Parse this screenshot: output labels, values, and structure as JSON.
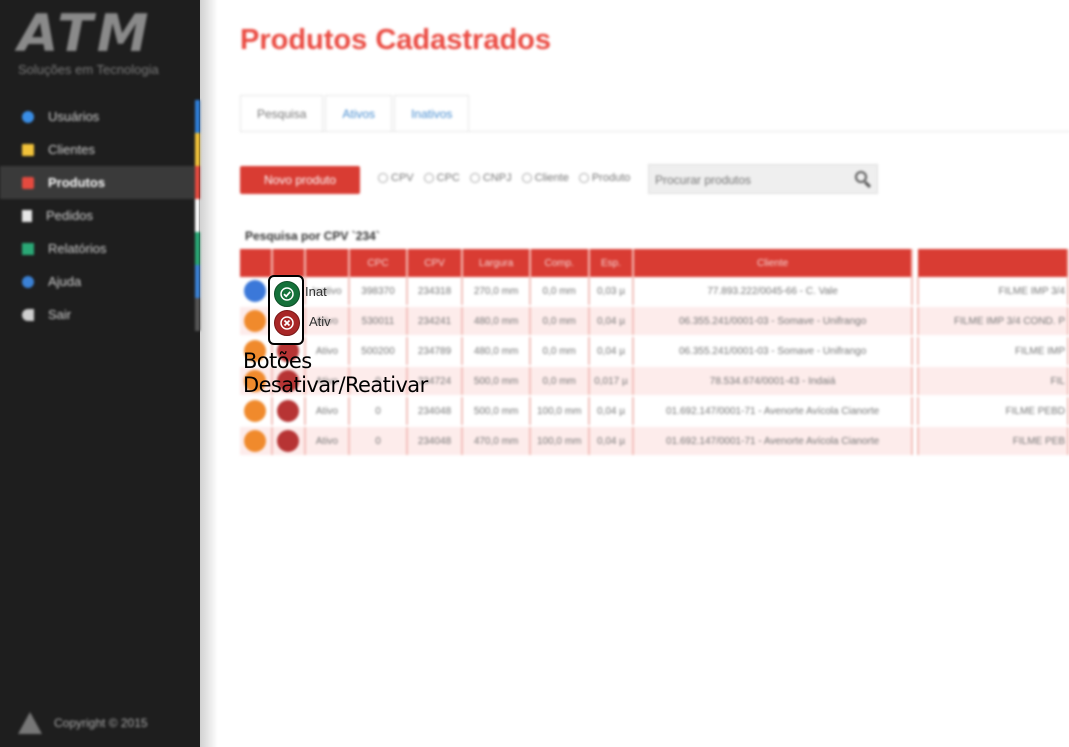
{
  "app": {
    "logo_text": "ATM",
    "logo_subtitle": "Soluções em Tecnologia",
    "footer": "Copyright © 2015"
  },
  "sidebar": {
    "items": [
      {
        "label": "Usuários",
        "icon": "user-icon",
        "icon_color": "#3a8ee6",
        "stripe": "#2f7ed8",
        "active": false
      },
      {
        "label": "Clientes",
        "icon": "envelope-icon",
        "icon_color": "#f2c33a",
        "stripe": "#f2c33a",
        "active": false
      },
      {
        "label": "Produtos",
        "icon": "product-icon",
        "icon_color": "#e54a3f",
        "stripe": "#e54a3f",
        "active": true
      },
      {
        "label": "Pedidos",
        "icon": "document-icon",
        "icon_color": "#e6e6e6",
        "stripe": "#ffffff",
        "active": false
      },
      {
        "label": "Relatórios",
        "icon": "chart-icon",
        "icon_color": "#2aa876",
        "stripe": "#2aa876",
        "active": false
      },
      {
        "label": "Ajuda",
        "icon": "help-icon",
        "icon_color": "#3b82d6",
        "stripe": "#3b82d6",
        "active": false
      },
      {
        "label": "Sair",
        "icon": "exit-icon",
        "icon_color": "#cfcfcf",
        "stripe": "#555555",
        "active": false
      }
    ]
  },
  "main": {
    "title": "Produtos Cadastrados",
    "tabs": [
      {
        "label": "Pesquisa",
        "active": true
      },
      {
        "label": "Ativos",
        "active": false
      },
      {
        "label": "Inativos",
        "active": false
      }
    ],
    "new_button": "Novo produto",
    "filters": [
      "CPV",
      "CPC",
      "CNPJ",
      "Cliente",
      "Produto"
    ],
    "search_placeholder": "Procurar produtos",
    "search_label": "Pesquisa por CPV `234`"
  },
  "table": {
    "headers": [
      "",
      "",
      "",
      "CPC",
      "CPV",
      "Largura",
      "Comp.",
      "Esp.",
      "Cliente",
      "",
      ""
    ],
    "rows": [
      {
        "btn1": "blue",
        "btn2": "green",
        "status": "Inativo",
        "cpc": "398370",
        "cpv": "234318",
        "largura": "270,0 mm",
        "comp": "0,0 mm",
        "esp": "0,03 µ",
        "cliente": "77.893.222/0045-66 - C. Vale",
        "produto": "FILME IMP 3/4"
      },
      {
        "btn1": "orange",
        "btn2": "red",
        "status": "Ativo",
        "cpc": "530011",
        "cpv": "234241",
        "largura": "480,0 mm",
        "comp": "0,0 mm",
        "esp": "0,04 µ",
        "cliente": "06.355.241/0001-03 - Somave - Unifrango",
        "produto": "FILME IMP 3/4 COND. P"
      },
      {
        "btn1": "orange",
        "btn2": "red",
        "status": "Ativo",
        "cpc": "500200",
        "cpv": "234789",
        "largura": "480,0 mm",
        "comp": "0,0 mm",
        "esp": "0,04 µ",
        "cliente": "06.355.241/0001-03 - Somave - Unifrango",
        "produto": "FILME IMP"
      },
      {
        "btn1": "orange",
        "btn2": "red",
        "status": "Ativo",
        "cpc": "0",
        "cpv": "234724",
        "largura": "500,0 mm",
        "comp": "0,0 mm",
        "esp": "0,017 µ",
        "cliente": "78.534.674/0001-43 - Indaiá",
        "produto": "FIL"
      },
      {
        "btn1": "orange",
        "btn2": "red",
        "status": "Ativo",
        "cpc": "0",
        "cpv": "234048",
        "largura": "500,0 mm",
        "comp": "100,0 mm",
        "esp": "0,04 µ",
        "cliente": "01.692.147/0001-71 - Avenorte Avícola Cianorte",
        "produto": "FILME PEBD"
      },
      {
        "btn1": "orange",
        "btn2": "red",
        "status": "Ativo",
        "cpc": "0",
        "cpv": "234048",
        "largura": "470,0 mm",
        "comp": "100,0 mm",
        "esp": "0,04 µ",
        "cliente": "01.692.147/0001-71 - Avenorte Avícola Cianorte",
        "produto": "FILME PEB"
      }
    ]
  },
  "annotation": {
    "caption": "Botões Desativar/Reativar",
    "row1_label": "Inat",
    "row2_label": "Ativ"
  }
}
